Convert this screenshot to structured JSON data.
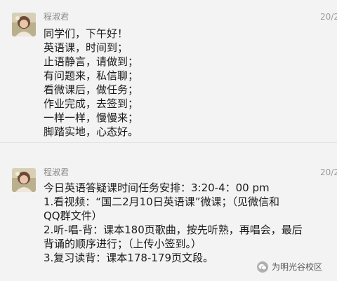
{
  "messages": [
    {
      "sender": "程淑君",
      "time": "20/2",
      "lines": [
        "同学们，下午好！",
        "英语课，时间到；",
        "止语静言，请做到；",
        "有问题来，私信聊；",
        "看微课后，做任务；",
        "作业完成，去签到；",
        "一样一样，慢慢来；",
        "脚踏实地，心态好。"
      ]
    },
    {
      "sender": "程淑君",
      "time": "20/2",
      "lines": [
        "今日英语答疑课时间任务安排：3:20-4：00 pm",
        "1.看视频：“国二2月10日英语课”微课；（见微信和",
        "QQ群文件）",
        "2.听-唱-背：课本180页歌曲，按先听熟，再唱会，最后",
        "背诵的顺序进行；（上传小签到。）",
        "3.复习读背：课本178-179页文段。"
      ]
    }
  ],
  "watermark": {
    "text": "为明光谷校区",
    "icon": "wechat-official-account-icon"
  }
}
